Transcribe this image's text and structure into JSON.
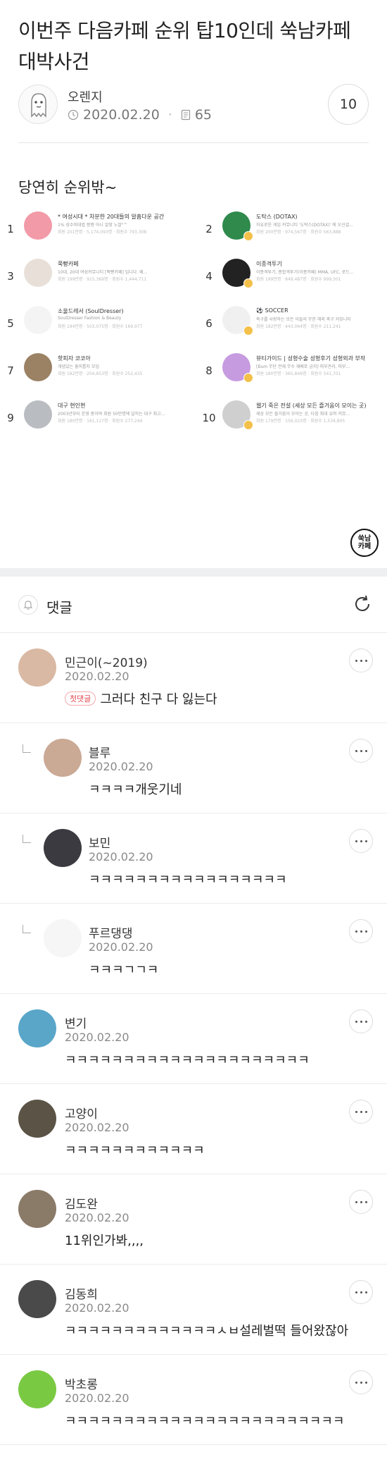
{
  "post": {
    "title": "이번주 다음카페 순위 탑10인데 쑥남카페 대박사건",
    "author": "오렌지",
    "date": "2020.02.20",
    "views": "65",
    "comment_count": "10",
    "body_text": "당연히 순위밖~"
  },
  "rankings": [
    {
      "rank": "1",
      "name": "* 여성시대 * 차분한 20대들의 알흠다운 공간",
      "desc": "1% 성수미대법 짱짱 아니 알맞 노잘\"^",
      "stats": "회원 201만명 · 5,174,093명 · 회원수 793,308",
      "color": "#f29aa8"
    },
    {
      "rank": "2",
      "name": "도탁스 (DOTAX)",
      "desc": "자유로운 게임 커뮤니티 '도탁스(DOTAX)' 에 오신걸...",
      "stats": "회원 200만명 · 974,567명 · 회원수 563,888",
      "color": "#2f8a4c"
    },
    {
      "rank": "3",
      "name": "쭉빵카페",
      "desc": "10대, 20대 여성커뮤니티 [쭉빵카페] 입니다. 왜...",
      "stats": "회원 199만명 · 915,369명 · 회원수 1,444,711",
      "color": "#e8e0d8"
    },
    {
      "rank": "4",
      "name": "이종격투기",
      "desc": "이종격투기, 종합격투기(이종카페) MMA, UFC, 로드...",
      "stats": "회원 199만명 · 849,487명 · 회원수 999,301",
      "color": "#222222"
    },
    {
      "rank": "5",
      "name": "소울드레서 (SoulDresser)",
      "desc": "SoulDresser Fashion & Beauty",
      "stats": "회원 194만명 · 503,075명 · 회원수 169,977",
      "color": "#f4f4f4"
    },
    {
      "rank": "6",
      "name": "⚽ SOCCER",
      "desc": "축구를 사랑하는 모든 이들의 무한 해외 축구 커뮤니티",
      "stats": "회원 182만명 · 443,064명 · 회원수 211,241",
      "color": "#f0f0f0"
    },
    {
      "rank": "7",
      "name": "핫피자 코코아",
      "desc": "개념있는 흥미롭지 모임",
      "stats": "회원 182만명 · 204,853명 · 회원수 252,435",
      "color": "#9b8264"
    },
    {
      "rank": "8",
      "name": "뷰티가이드 | 성형수술 성형후기 성형외과 부작",
      "desc": "[Bum 무단 전재 무수 재배포 금지] 피부관리, 피부...",
      "stats": "회원 180만명 · 365,846명 · 회원수 541,701",
      "color": "#c79be0"
    },
    {
      "rank": "9",
      "name": "대구 현인현",
      "desc": "2003년부터 운영 중이며 회원 50만명에 달하는 대구 최고...",
      "stats": "회원 180만명 · 161,117명 · 회원수 277,244",
      "color": "#b9bcc0"
    },
    {
      "rank": "10",
      "name": "웹기 죽은 전설 (세상 모든 즐거움이 모이는 곳)",
      "desc": "세상 모든 즐거움이 모이는 곳, 다음 최대 유머 커뮤...",
      "stats": "회원 179만명 · 156,023명 · 회원수 1,534,805",
      "color": "#cfcfcf"
    }
  ],
  "cafe_logo": {
    "line1": "쑥남",
    "line2": "카페"
  },
  "comments_section": {
    "title": "댓글"
  },
  "comments": [
    {
      "name": "민근이(~2019)",
      "date": "2020.02.20",
      "badge": "첫댓글",
      "text": "그러다 친구 다 잃는다",
      "reply": false,
      "avatar_color": "#d9b9a4"
    },
    {
      "name": "블루",
      "date": "2020.02.20",
      "badge": "",
      "text": "ㅋㅋㅋㅋ개웃기네",
      "reply": true,
      "avatar_color": "#caa995"
    },
    {
      "name": "보민",
      "date": "2020.02.20",
      "badge": "",
      "text": "ㅋㅋㅋㅋㅋㅋㅋㅋㅋㅋㅋㅋㅋㅋㅋㅋㅋ",
      "reply": true,
      "avatar_color": "#3a3a40"
    },
    {
      "name": "푸르댕댕",
      "date": "2020.02.20",
      "badge": "",
      "text": "ㅋㅋㅋㄱㄱㅋ",
      "reply": true,
      "avatar_color": "#f6f6f6"
    },
    {
      "name": "변기",
      "date": "2020.02.20",
      "badge": "",
      "text": "ㅋㅋㅋㅋㅋㅋㅋㅋㅋㅋㅋㅋㅋㅋㅋㅋㅋㅋㅋㅋㅋ",
      "reply": false,
      "avatar_color": "#5aa6c9"
    },
    {
      "name": "고양이",
      "date": "2020.02.20",
      "badge": "",
      "text": "ㅋㅋㅋㅋㅋㅋㅋㅋㅋㅋㅋㅋ",
      "reply": false,
      "avatar_color": "#5b5346"
    },
    {
      "name": "김도완",
      "date": "2020.02.20",
      "badge": "",
      "text": "11위인가봐,,,,",
      "reply": false,
      "avatar_color": "#8a7a68"
    },
    {
      "name": "김동희",
      "date": "2020.02.20",
      "badge": "",
      "text": "ㅋㅋㅋㅋㅋㅋㅋㅋㅋㅋㅋㅋㅋㅅㅂ설레벌떡 들어왔잖아",
      "reply": false,
      "avatar_color": "#4a4a4a"
    },
    {
      "name": "박초롱",
      "date": "2020.02.20",
      "badge": "",
      "text": "ㅋㅋㅋㅋㅋㅋㅋㅋㅋㅋㅋㅋㅋㅋㅋㅋㅋㅋㅋㅋㅋㅋㅋㅋ",
      "reply": false,
      "avatar_color": "#7ac943"
    }
  ]
}
